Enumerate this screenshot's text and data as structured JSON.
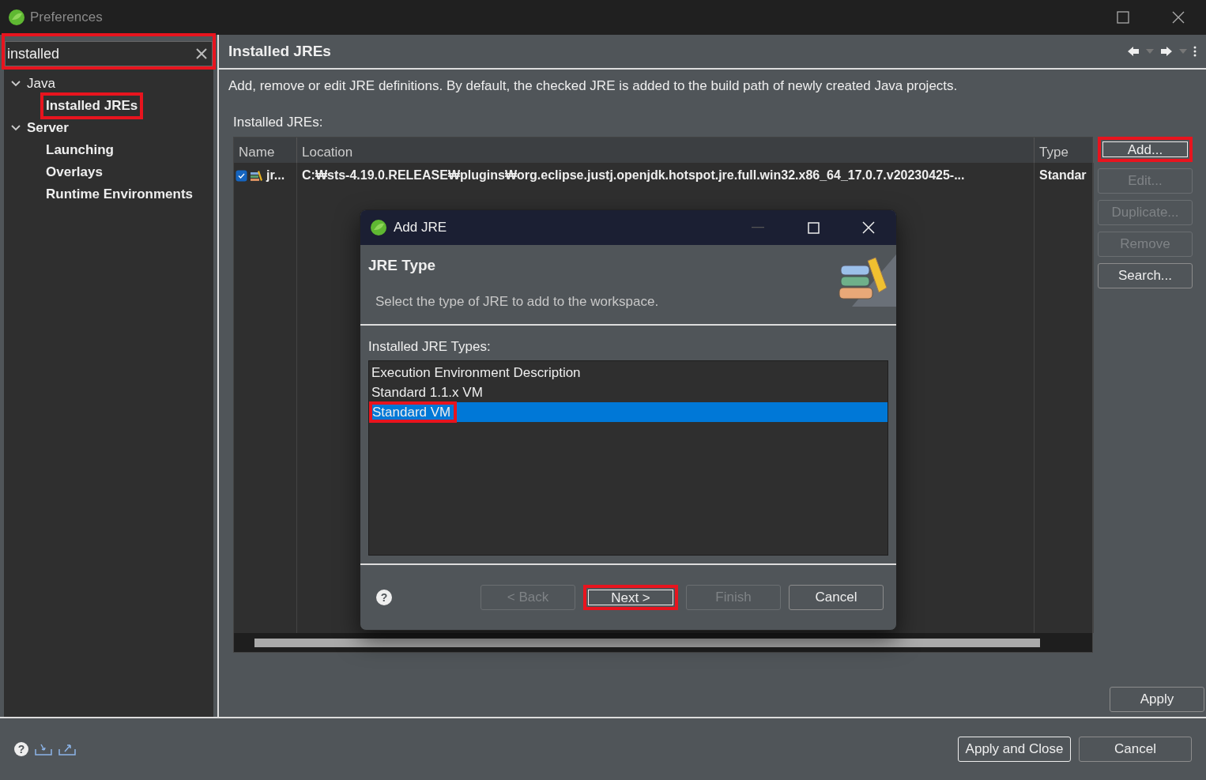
{
  "window": {
    "title": "Preferences"
  },
  "filter": {
    "value": "installed",
    "highlighted": true
  },
  "tree": [
    {
      "label": "Java",
      "matched": false,
      "expanded": true,
      "children": [
        {
          "label": "Installed JREs",
          "matched": true,
          "highlighted": true
        }
      ]
    },
    {
      "label": "Server",
      "matched": true,
      "expanded": true,
      "children": [
        {
          "label": "Launching",
          "matched": true,
          "highlighted": false
        },
        {
          "label": "Overlays",
          "matched": true,
          "highlighted": false
        },
        {
          "label": "Runtime Environments",
          "matched": true,
          "highlighted": false
        }
      ]
    }
  ],
  "page": {
    "title": "Installed JREs",
    "description": "Add, remove or edit JRE definitions. By default, the checked JRE is added to the build path of newly created Java projects.",
    "table_label": "Installed JREs:"
  },
  "table": {
    "columns": [
      "Name",
      "Location",
      "Type"
    ],
    "rows": [
      {
        "checked": true,
        "name": "jr...",
        "location": "C:₩sts-4.19.0.RELEASE₩plugins₩org.eclipse.justj.openjdk.hotspot.jre.full.win32.x86_64_17.0.7.v20230425-...",
        "type": "Standar"
      }
    ]
  },
  "side_buttons": [
    {
      "label": "Add...",
      "disabled": false,
      "highlighted": true
    },
    {
      "label": "Edit...",
      "disabled": true,
      "highlighted": false
    },
    {
      "label": "Duplicate...",
      "disabled": true,
      "highlighted": false
    },
    {
      "label": "Remove",
      "disabled": true,
      "highlighted": false
    },
    {
      "label": "Search...",
      "disabled": false,
      "highlighted": false
    }
  ],
  "apply_button": "Apply",
  "footer_buttons": [
    "Apply and Close",
    "Cancel"
  ],
  "footer_help_icon": "?",
  "dialog": {
    "title": "Add JRE",
    "heading": "JRE Type",
    "message": "Select the type of JRE to add to the workspace.",
    "list_label": "Installed JRE Types:",
    "types": [
      {
        "label": "Execution Environment Description",
        "selected": false,
        "highlighted": false
      },
      {
        "label": "Standard 1.1.x VM",
        "selected": false,
        "highlighted": false
      },
      {
        "label": "Standard VM",
        "selected": true,
        "highlighted": true
      }
    ],
    "help_icon": "?",
    "buttons": [
      {
        "label": "< Back",
        "disabled": true,
        "highlighted": false
      },
      {
        "label": "Next >",
        "disabled": false,
        "highlighted": true
      },
      {
        "label": "Finish",
        "disabled": true,
        "highlighted": false
      },
      {
        "label": "Cancel",
        "disabled": false,
        "highlighted": false
      }
    ]
  }
}
